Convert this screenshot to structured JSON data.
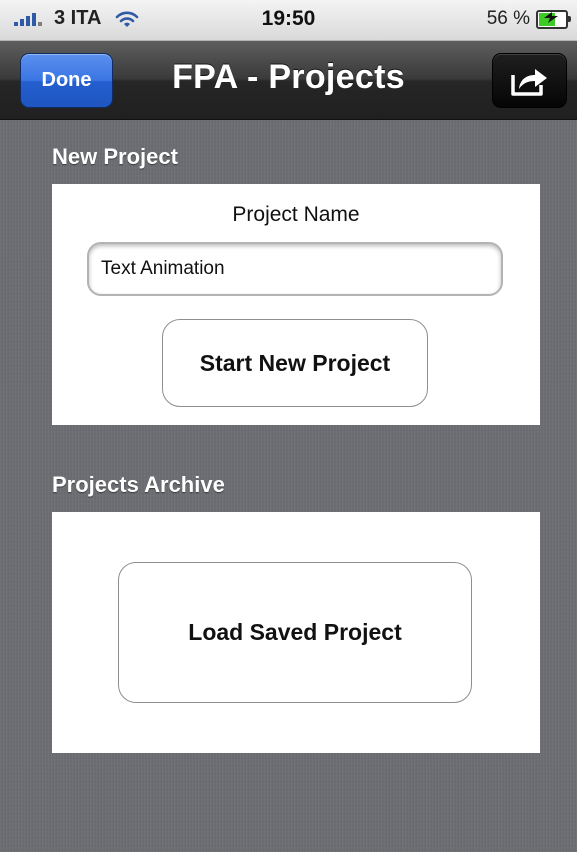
{
  "status_bar": {
    "carrier": "3 ITA",
    "time": "19:50",
    "battery_text": "56 %",
    "battery_level": 0.56,
    "signal_icon": "signal-bars-icon",
    "wifi_icon": "wifi-icon",
    "battery_icon": "battery-charging-icon"
  },
  "nav_bar": {
    "title": "FPA - Projects",
    "done_label": "Done",
    "share_icon": "share-icon"
  },
  "new_project": {
    "section_title": "New Project",
    "field_label": "Project Name",
    "field_value": "Text Animation",
    "start_button_label": "Start New Project"
  },
  "archive": {
    "section_title": "Projects Archive",
    "load_button_label": "Load Saved Project"
  },
  "colors": {
    "done_button": "#2f6bd9",
    "nav_background": "#2a2a2a",
    "content_background": "#6b6d72",
    "battery_fill": "#3ecb27"
  }
}
